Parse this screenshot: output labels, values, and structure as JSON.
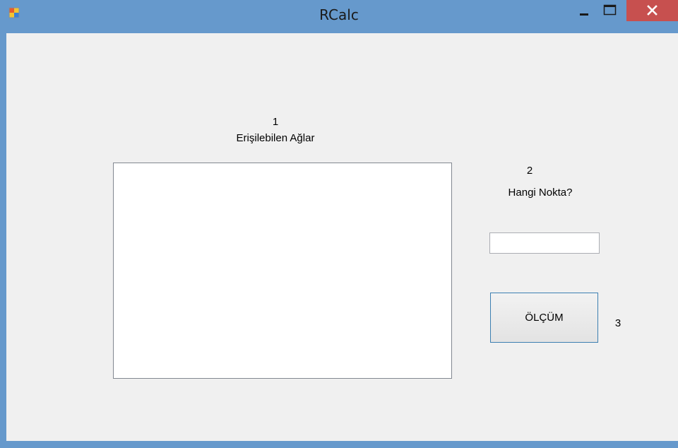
{
  "window": {
    "title": "RCalc",
    "icon": "winforms-app-icon",
    "controls": {
      "minimize_icon": "minimize-icon",
      "maximize_icon": "maximize-icon",
      "close_icon": "close-icon"
    },
    "colors": {
      "titlebar": "#6699cc",
      "close_button": "#c7504f",
      "client_background": "#f0f0f0"
    }
  },
  "form": {
    "list_section": {
      "number": "1",
      "label": "Erişilebilen Ağlar",
      "items": []
    },
    "point_section": {
      "number": "2",
      "label": "Hangi Nokta?",
      "input_value": ""
    },
    "measure_section": {
      "button_label": "ÖLÇÜM",
      "number": "3"
    }
  }
}
